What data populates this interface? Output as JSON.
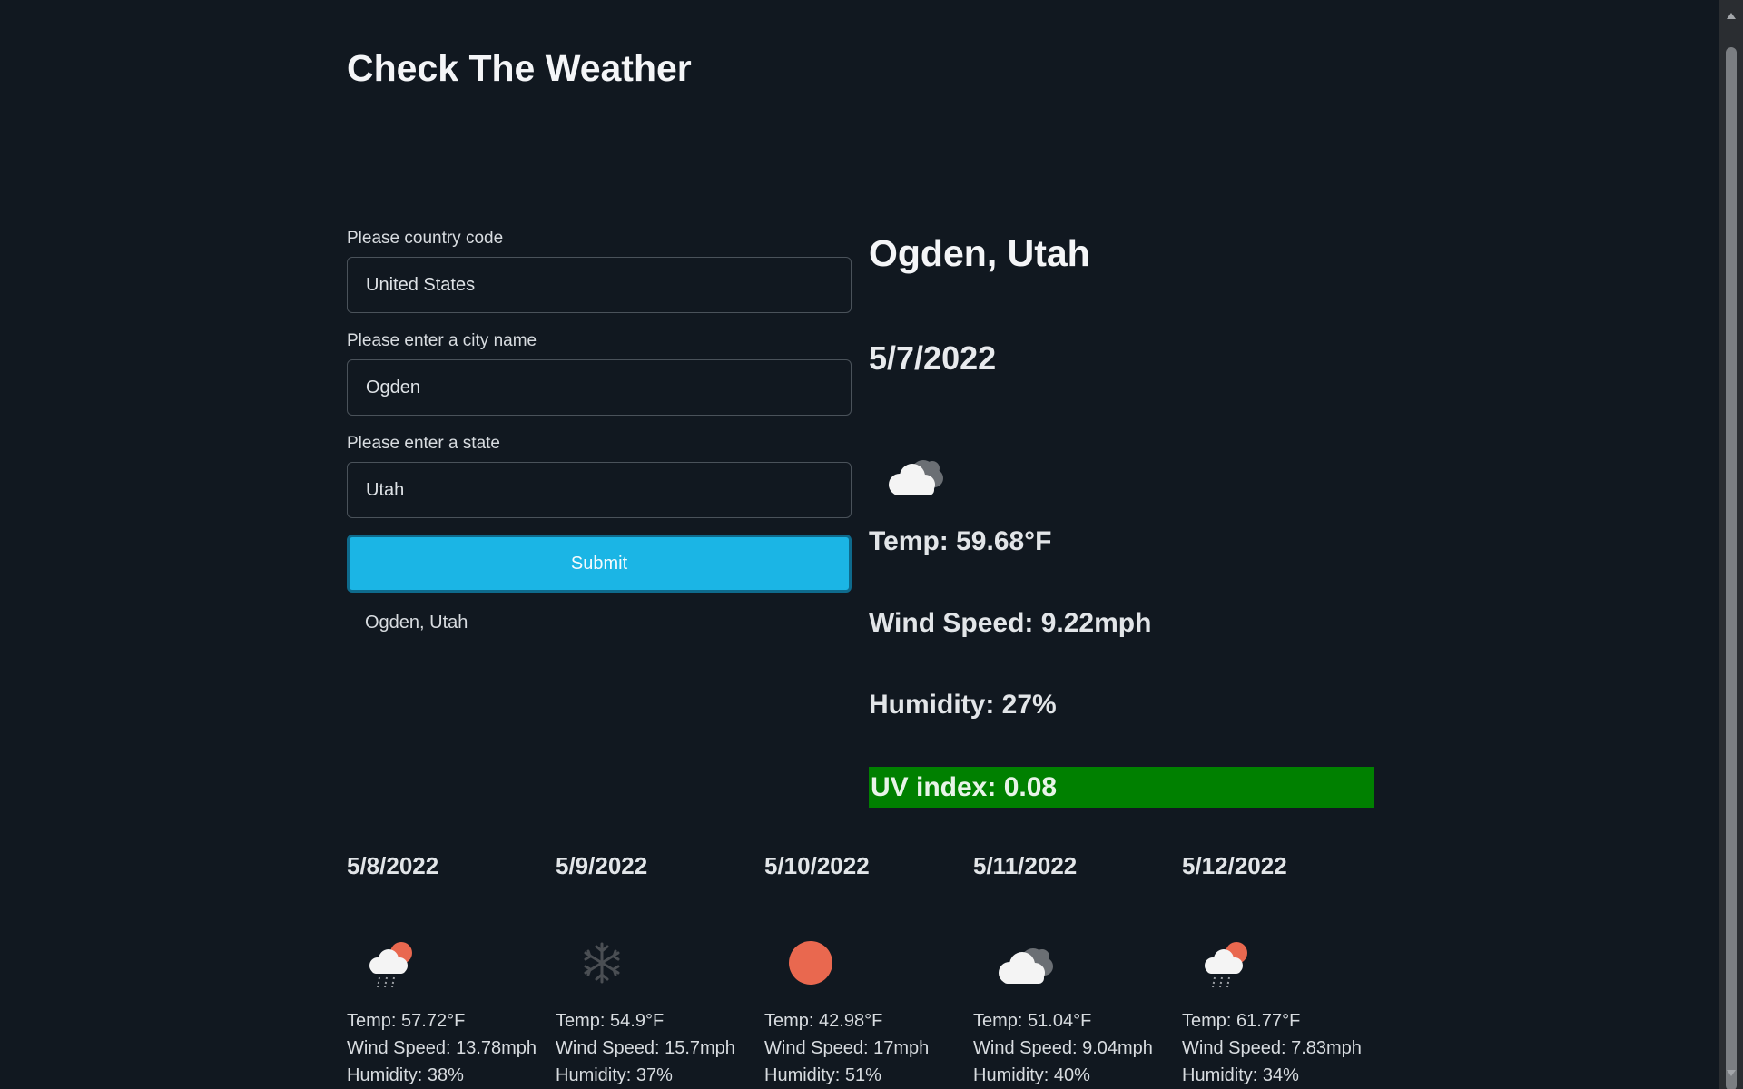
{
  "app": {
    "title": "Check The Weather"
  },
  "form": {
    "country_label": "Please country code",
    "country_value": "United States",
    "city_label": "Please enter a city name",
    "city_value": "Ogden",
    "state_label": "Please enter a state",
    "state_value": "Utah",
    "submit_label": "Submit",
    "history": [
      "Ogden, Utah"
    ]
  },
  "current": {
    "city": "Ogden, Utah",
    "date": "5/7/2022",
    "icon": "cloudy-icon",
    "temp": "Temp: 59.68°F",
    "wind": "Wind Speed: 9.22mph",
    "humidity": "Humidity: 27%",
    "uv": "UV index: 0.08",
    "uv_color": "#008000"
  },
  "forecast": [
    {
      "date": "5/8/2022",
      "icon": "rain-sun-icon",
      "temp": "Temp: 57.72°F",
      "wind": "Wind Speed: 13.78mph",
      "humidity": "Humidity: 38%"
    },
    {
      "date": "5/9/2022",
      "icon": "snow-icon",
      "temp": "Temp: 54.9°F",
      "wind": "Wind Speed: 15.7mph",
      "humidity": "Humidity: 37%"
    },
    {
      "date": "5/10/2022",
      "icon": "sun-icon",
      "temp": "Temp: 42.98°F",
      "wind": "Wind Speed: 17mph",
      "humidity": "Humidity: 51%"
    },
    {
      "date": "5/11/2022",
      "icon": "cloudy-icon",
      "temp": "Temp: 51.04°F",
      "wind": "Wind Speed: 9.04mph",
      "humidity": "Humidity: 40%"
    },
    {
      "date": "5/12/2022",
      "icon": "rain-sun-icon",
      "temp": "Temp: 61.77°F",
      "wind": "Wind Speed: 7.83mph",
      "humidity": "Humidity: 34%"
    }
  ],
  "colors": {
    "background": "#111820",
    "accent": "#1bb5e5",
    "sun": "#e9684f",
    "uv_low": "#008000"
  }
}
